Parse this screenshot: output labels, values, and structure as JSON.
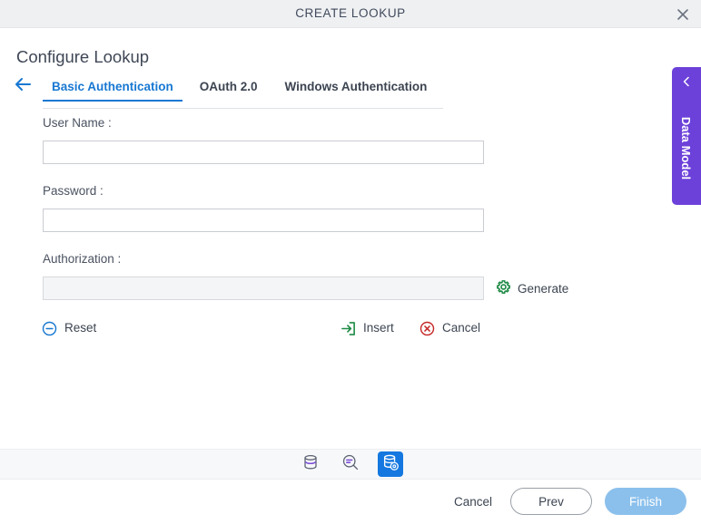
{
  "window": {
    "title": "CREATE LOOKUP",
    "close_icon": "close-icon"
  },
  "page": {
    "heading": "Configure Lookup",
    "back_icon": "arrow-left-icon"
  },
  "tabs": [
    {
      "label": "Basic Authentication",
      "active": true
    },
    {
      "label": "OAuth 2.0",
      "active": false
    },
    {
      "label": "Windows Authentication",
      "active": false
    }
  ],
  "form": {
    "username": {
      "label": "User Name :",
      "value": "",
      "placeholder": ""
    },
    "password": {
      "label": "Password :",
      "value": "",
      "placeholder": ""
    },
    "authorization": {
      "label": "Authorization :",
      "value": "",
      "placeholder": "",
      "readonly": true
    },
    "generate": {
      "label": "Generate",
      "icon": "gear-icon",
      "color": "#1e8a45"
    }
  },
  "actions": [
    {
      "label": "Reset",
      "icon": "minus-circle-icon",
      "color": "#1878d2"
    },
    {
      "label": "Insert",
      "icon": "insert-arrow-icon",
      "color": "#1e8a45"
    },
    {
      "label": "Cancel",
      "icon": "close-circle-icon",
      "color": "#c52828"
    }
  ],
  "toolbar": {
    "items": [
      {
        "name": "database-icon",
        "selected": false
      },
      {
        "name": "search-query-icon",
        "selected": false
      },
      {
        "name": "database-settings-icon",
        "selected": true
      }
    ],
    "accent": "#1478e0",
    "icon_color": "#7b4fd6"
  },
  "footer": {
    "cancel_label": "Cancel",
    "prev_label": "Prev",
    "finish_label": "Finish",
    "finish_color": "#8bc0ec"
  },
  "side_panel": {
    "label": "Data Model",
    "chevron_icon": "chevron-left-icon",
    "color": "#6c41d9"
  }
}
